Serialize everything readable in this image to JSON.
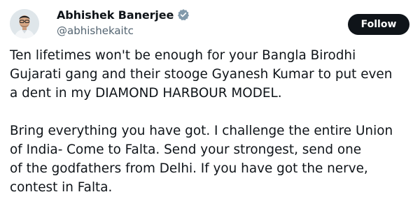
{
  "author": {
    "display_name": "Abhishek Banerjee",
    "handle": "@abhishekaitc",
    "verified_icon": "verified-badge-icon"
  },
  "follow_button": {
    "label": "Follow"
  },
  "tweet": {
    "paragraph1_lines": [
      "Ten lifetimes won't be enough for your Bangla Birodhi",
      "Gujarati gang and their stooge Gyanesh Kumar to put even",
      "a dent in my DIAMOND HARBOUR MODEL."
    ],
    "paragraph2_lines": [
      "Bring everything you have got. I challenge the entire Union",
      "of India- Come to Falta. Send your strongest, send one",
      "of the godfathers from Delhi. If you have got the nerve,",
      "contest in Falta."
    ]
  },
  "colors": {
    "text": "#0f1419",
    "secondary_text": "#536471",
    "button_bg": "#0f1419",
    "button_text": "#ffffff",
    "verified": "#829aab"
  }
}
